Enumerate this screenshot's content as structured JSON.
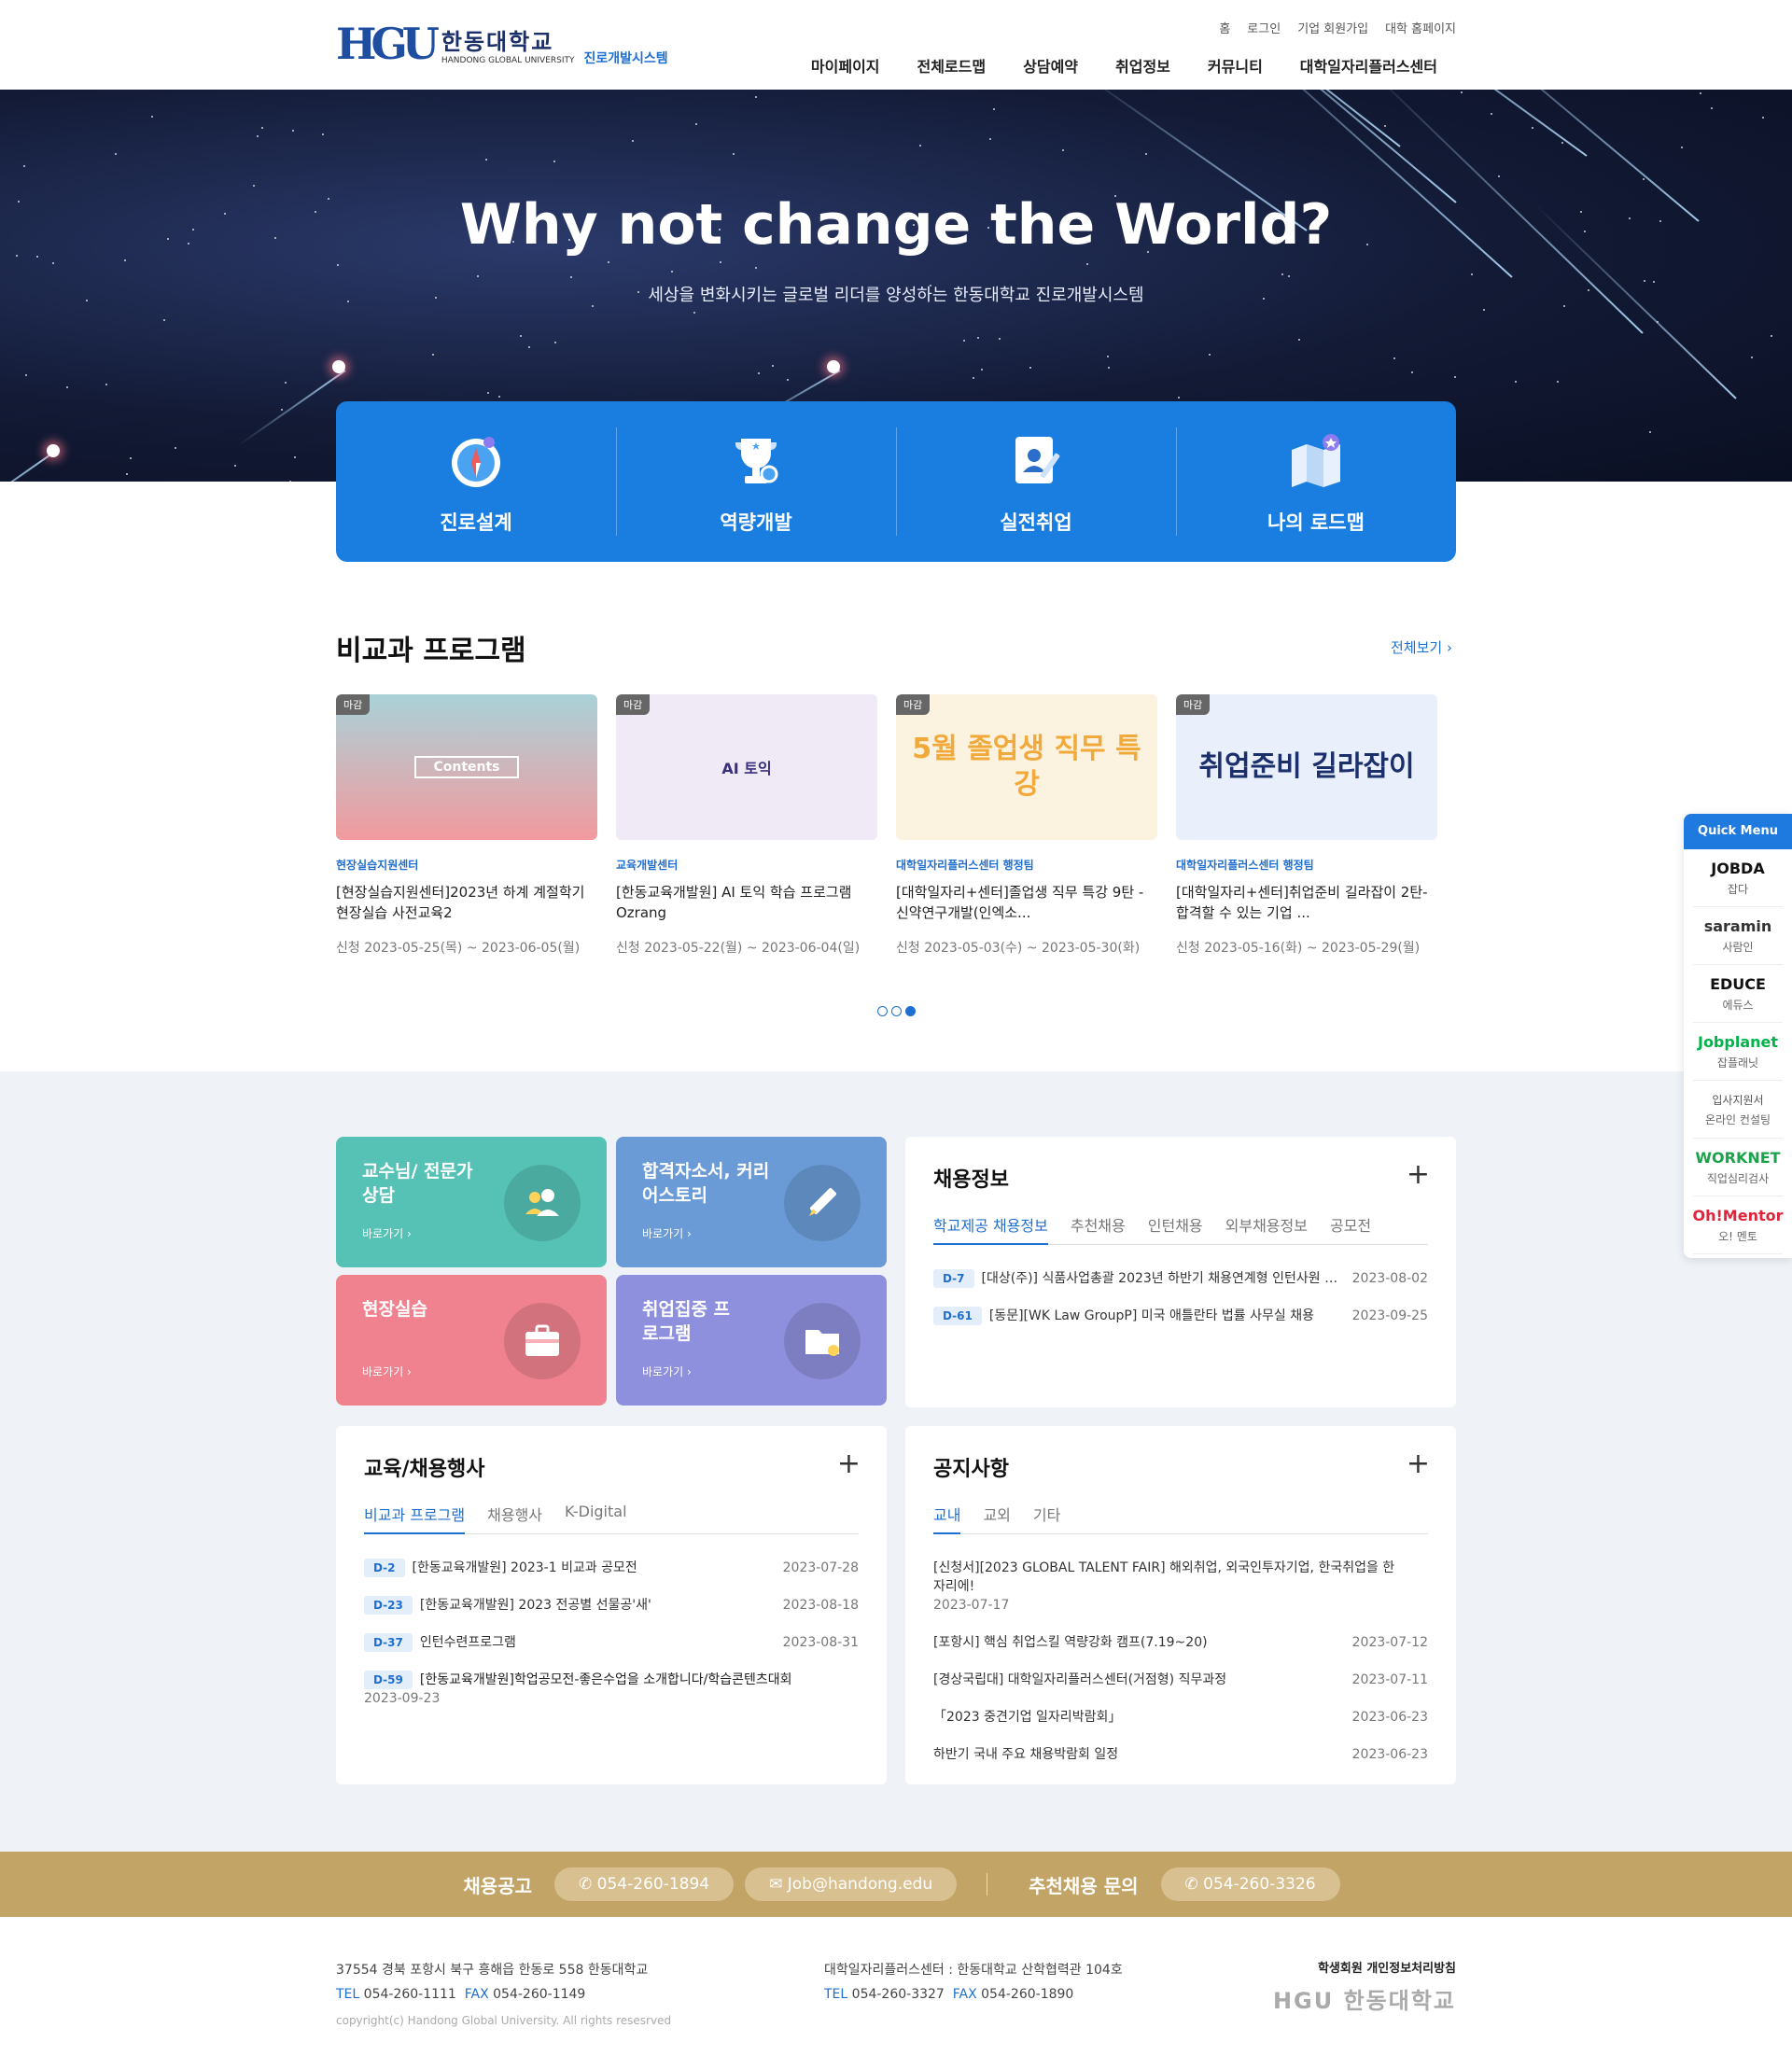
{
  "header": {
    "logo_mark": "HGU",
    "logo_kr": "한동대학교",
    "logo_en": "HANDONG GLOBAL UNIVERSITY",
    "logo_system": "진로개발시스템",
    "topnav": [
      "홈",
      "로그인",
      "기업 회원가입",
      "대학 홈페이지"
    ],
    "gnb": [
      "마이페이지",
      "전체로드맵",
      "상담예약",
      "취업정보",
      "커뮤니티",
      "대학일자리플러스센터"
    ]
  },
  "hero": {
    "title": "Why not change the World?",
    "subtitle": "세상을 변화시키는 글로벌 리더를 양성하는 한동대학교 진로개발시스템"
  },
  "quick": [
    {
      "label": "진로설계",
      "icon": "compass-icon"
    },
    {
      "label": "역량개발",
      "icon": "trophy-icon"
    },
    {
      "label": "실전취업",
      "icon": "id-card-icon"
    },
    {
      "label": "나의 로드맵",
      "icon": "map-icon"
    }
  ],
  "programs": {
    "title": "비교과 프로그램",
    "more": "전체보기 ›",
    "cards": [
      {
        "badge": "마감",
        "thumb_text": "Contents",
        "category": "현장실습지원센터",
        "title": "[현장실습지원센터]2023년 하계 계절학기 현장실습 사전교육2",
        "date": "신청 2023-05-25(목) ~ 2023-06-05(월)"
      },
      {
        "badge": "마감",
        "thumb_text": "AI 토익",
        "category": "교육개발센터",
        "title": "[한동교육개발원] AI 토익 학습 프로그램 Ozrang",
        "date": "신청 2023-05-22(월) ~ 2023-06-04(일)"
      },
      {
        "badge": "마감",
        "thumb_text": "5월 졸업생 직무 특강",
        "category": "대학일자리플러스센터 행정팀",
        "title": "[대학일자리+센터]졸업생 직무 특강 9탄 - 신약연구개발(인엑소...",
        "date": "신청 2023-05-03(수) ~ 2023-05-30(화)"
      },
      {
        "badge": "마감",
        "thumb_text": "취업준비 길라잡이",
        "category": "대학일자리플러스센터 행정팀",
        "title": "[대학일자리+센터]취업준비 길라잡이 2탄-합격할 수 있는 기업 ...",
        "date": "신청 2023-05-16(화) ~ 2023-05-29(월)"
      }
    ]
  },
  "tiles": [
    {
      "title": "교수님/ 전문가 상담",
      "go": "바로가기 ›",
      "color": "#56c2b6",
      "icon": "consult-icon"
    },
    {
      "title": "합격자소서, 커리어스토리",
      "go": "바로가기 ›",
      "color": "#6a9bd6",
      "icon": "pencil-icon"
    },
    {
      "title": "현장실습",
      "go": "바로가기 ›",
      "color": "#f0828f",
      "icon": "briefcase-icon"
    },
    {
      "title": "취업집중 프로그램",
      "go": "바로가기 ›",
      "color": "#8f90dd",
      "icon": "folder-icon"
    }
  ],
  "jobs": {
    "title": "채용정보",
    "tabs": [
      "학교제공 채용정보",
      "추천채용",
      "인턴채용",
      "외부채용정보",
      "공모전"
    ],
    "rows": [
      {
        "dday": "D-7",
        "text": "[대상(주)] 식품사업총괄 2023년 하반기 채용연계형 인턴사원 모...",
        "date": "2023-08-02"
      },
      {
        "dday": "D-61",
        "text": "[동문][WK Law GroupP] 미국 애틀란타 법률 사무실 채용",
        "date": "2023-09-25"
      }
    ]
  },
  "events": {
    "title": "교육/채용행사",
    "tabs": [
      "비교과 프로그램",
      "채용행사",
      "K-Digital"
    ],
    "rows": [
      {
        "dday": "D-2",
        "text": "[한동교육개발원] 2023-1 비교과 공모전",
        "date": "2023-07-28"
      },
      {
        "dday": "D-23",
        "text": "[한동교육개발원] 2023 전공별 선물공'새'",
        "date": "2023-08-18"
      },
      {
        "dday": "D-37",
        "text": "인턴수련프로그램",
        "date": "2023-08-31"
      },
      {
        "dday": "D-59",
        "text": "[한동교육개발원]학업공모전-좋은수업을 소개합니다/학습콘텐츠대회",
        "date": "2023-09-23"
      }
    ]
  },
  "notices": {
    "title": "공지사항",
    "tabs": [
      "교내",
      "교외",
      "기타"
    ],
    "rows": [
      {
        "text": "[신청서][2023 GLOBAL TALENT FAIR] 해외취업, 외국인투자기업, 한국취업을 한 자리에!",
        "date": "2023-07-17"
      },
      {
        "text": "[포항시] 핵심 취업스킬 역량강화 캠프(7.19~20)",
        "date": "2023-07-12"
      },
      {
        "text": "[경상국립대] 대학일자리플러스센터(거점형) 직무과정",
        "date": "2023-07-11"
      },
      {
        "text": "「2023 중견기업 일자리박람회」",
        "date": "2023-06-23"
      },
      {
        "text": "하반기 국내 주요 채용박람회 일정",
        "date": "2023-06-23"
      }
    ]
  },
  "quick_menu": {
    "title": "Quick Menu",
    "items": [
      {
        "logo": "JOBDA",
        "sub": "잡다",
        "color": "#111111"
      },
      {
        "logo": "saramin",
        "sub": "사람인",
        "color": "#333333"
      },
      {
        "logo": "EDUCE",
        "sub": "에듀스",
        "color": "#111111"
      },
      {
        "logo": "Jobplanet",
        "sub": "잡플래닛",
        "color": "#00b34a"
      },
      {
        "logo": "입사지원서",
        "sub": "온라인 컨설팅",
        "color": "#555555"
      },
      {
        "logo": "WORKNET",
        "sub": "직업심리검사",
        "color": "#1aa34a"
      },
      {
        "logo": "Oh!Mentor",
        "sub": "오! 멘토",
        "color": "#e0243a"
      }
    ]
  },
  "contact": {
    "label1": "채용공고",
    "phone1": "054-260-1894",
    "email": "Job@handong.edu",
    "label2": "추천채용 문의",
    "phone2": "054-260-3326"
  },
  "footer": {
    "address": "37554 경북 포항시 북구 흥해읍 한동로 558 한동대학교",
    "tel_label": "TEL",
    "tel": "054-260-1111",
    "fax_label": "FAX",
    "fax": "054-260-1149",
    "center": "대학일자리플러스센터 : 한동대학교 산학협력관 104호",
    "center_tel": "054-260-3327",
    "center_fax": "054-260-1890",
    "copyright": "copyright(c) Handong Global University. All rights resesrved",
    "privacy": "학생회원 개인정보처리방침",
    "logo": "HGU 한동대학교"
  }
}
